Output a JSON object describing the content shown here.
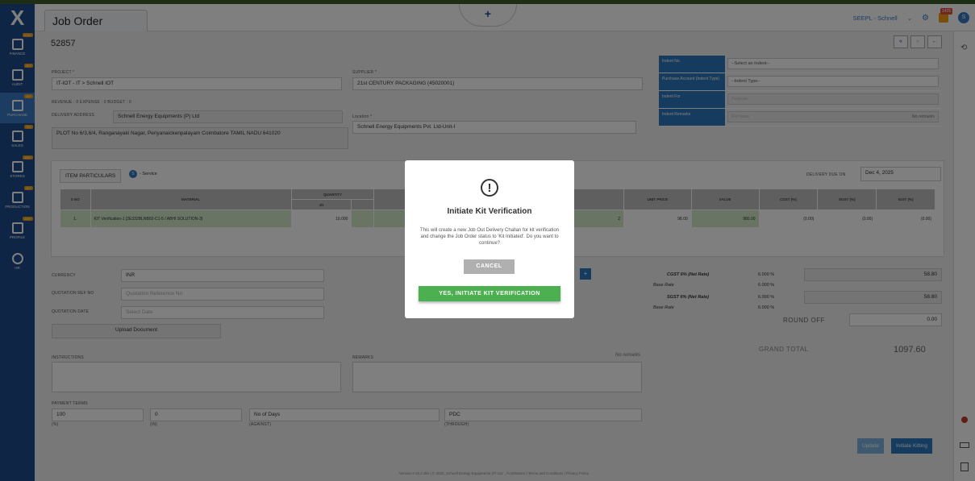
{
  "app": {
    "logo": "X",
    "tab_title": "Job Order",
    "new_icon": "+"
  },
  "sidebar": [
    {
      "label": "FINANCE",
      "badge": "213+"
    },
    {
      "label": "AUDIT",
      "badge": "20+"
    },
    {
      "label": "PURCHASE",
      "badge": "40+",
      "active": true
    },
    {
      "label": "SALES",
      "badge": "70+"
    },
    {
      "label": "STORES",
      "badge": "100+"
    },
    {
      "label": "PRODUCTION",
      "badge": "20+"
    },
    {
      "label": "PROFILE",
      "badge": "100+"
    },
    {
      "label": "HR",
      "badge": ""
    }
  ],
  "header": {
    "company": "SEEPL - Schnell",
    "notif_count": "1425",
    "avatar": "S"
  },
  "job": {
    "number": "52857"
  },
  "form": {
    "project_label": "PROJECT *",
    "project": "IT-IOT - IT > Schnell IOT",
    "supplier_label": "SUPPLIER *",
    "supplier": "21st CENTURY PACKAGING (45020001)",
    "rev_line": "REVENUE : 0   EXPENSE : 0   BUDGET : 0",
    "delivery_label": "DELIVERY ADDRESS",
    "delivery_name": "Schnell Energy Equipments (P) Ltd",
    "delivery_addr": "PLOT No 6/3,6/4, Ranganayaki Nagar, Periyanaickenpalayam  Coimbatore TAMIL NADU 641020",
    "location_label": "Location *",
    "location": "Schnell Energy Equipments Pvt. Ltd-Unit-I"
  },
  "indent": {
    "no_label": "Indent No.",
    "no_value": "--Select an Indent--",
    "pa_label": "Purchase Account (Indent Type)",
    "pa_value": "--Indent Type--",
    "for_label": "Indent For",
    "for_value": "Purpose",
    "rem_label": "Indent Remarks",
    "rem_value": "Remarks",
    "rem_note": "No remarks"
  },
  "items": {
    "tab": "ITEM PARTICULARS",
    "service_badge": "S",
    "service_label": "- Service",
    "due_label": "DELIVERY DUE ON",
    "due_date": "Dec 4, 2025",
    "headers": {
      "sno": "S NO",
      "material": "MATERIAL",
      "quantity": "QUANTITY",
      "jo": "JO",
      "unit_price": "UNIT PRICE",
      "value": "VALUE",
      "cgst": "CGST (%)",
      "sgst": "SGST (%)",
      "igst": "IGST (%)"
    },
    "row": {
      "sno": "1.",
      "material": "KIT Verification-1 [2E332BLNB02-C1-5 / ABHI SOLUTION-3]",
      "qty": "10.000",
      "ord": "2",
      "unit_price": "98.00",
      "up_sub": "(0.00)",
      "value": "980.00",
      "g1": "(0.00)",
      "g2": "(0.00)",
      "g3": "(0.00)"
    }
  },
  "bottom": {
    "currency_label": "CURRENCY",
    "currency": "INR",
    "qref_label": "QUOTATION REF NO",
    "qref_ph": "Quotation Reference No",
    "qdate_label": "QUOTATION DATE",
    "qdate_ph": "Select Date",
    "upload": "Upload Document",
    "instructions": "INSTRUCTIONS",
    "remarks": "REMARKS",
    "no_remarks": "No remarks",
    "payment_label": "PAYMENT TERMS",
    "p1": "100",
    "p1_sub": "(%)",
    "p2": "0",
    "p2_sub": "(in)",
    "p3": "No of Days",
    "p3_sub": "(against)",
    "p4": "PDC",
    "p4_sub": "(through)"
  },
  "tax": {
    "cgst": "CGST 6% (Net Rate)",
    "cgst_pct": "6.000 %",
    "cgst_base": "Base Rate",
    "cgst_base_pct": "6.000 %",
    "cgst_amt": "58.80",
    "sgst": "SGST 6% (Net Rate)",
    "sgst_pct": "6.000 %",
    "sgst_base": "Base Rate",
    "sgst_base_pct": "6.000 %",
    "sgst_amt": "58.80",
    "roundoff_label": "ROUND OFF",
    "roundoff": "0.00",
    "grand_label": "GRAND TOTAL",
    "grand": "1097.60"
  },
  "actions": {
    "update": "Update",
    "kitting": "Initiate Kitting"
  },
  "footer": "Version 2.16.2 dev | © 2022, Schnell Energy Equipments (P) Ltd. , Coimbatore | Terms and Conditions | Privacy Policy",
  "modal": {
    "icon": "!",
    "title": "Initiate Kit Verification",
    "text": "This will create a new Job Out Delivery Challan for kit verification and change the Job Order status to 'Kit Initiated'. Do you want to continue?",
    "cancel": "CANCEL",
    "confirm": "YES, INITIATE KIT VERIFICATION"
  },
  "colors": {
    "sidebar": "#1f4b8c",
    "accent": "#2a76bf",
    "confirm": "#4caf50"
  }
}
